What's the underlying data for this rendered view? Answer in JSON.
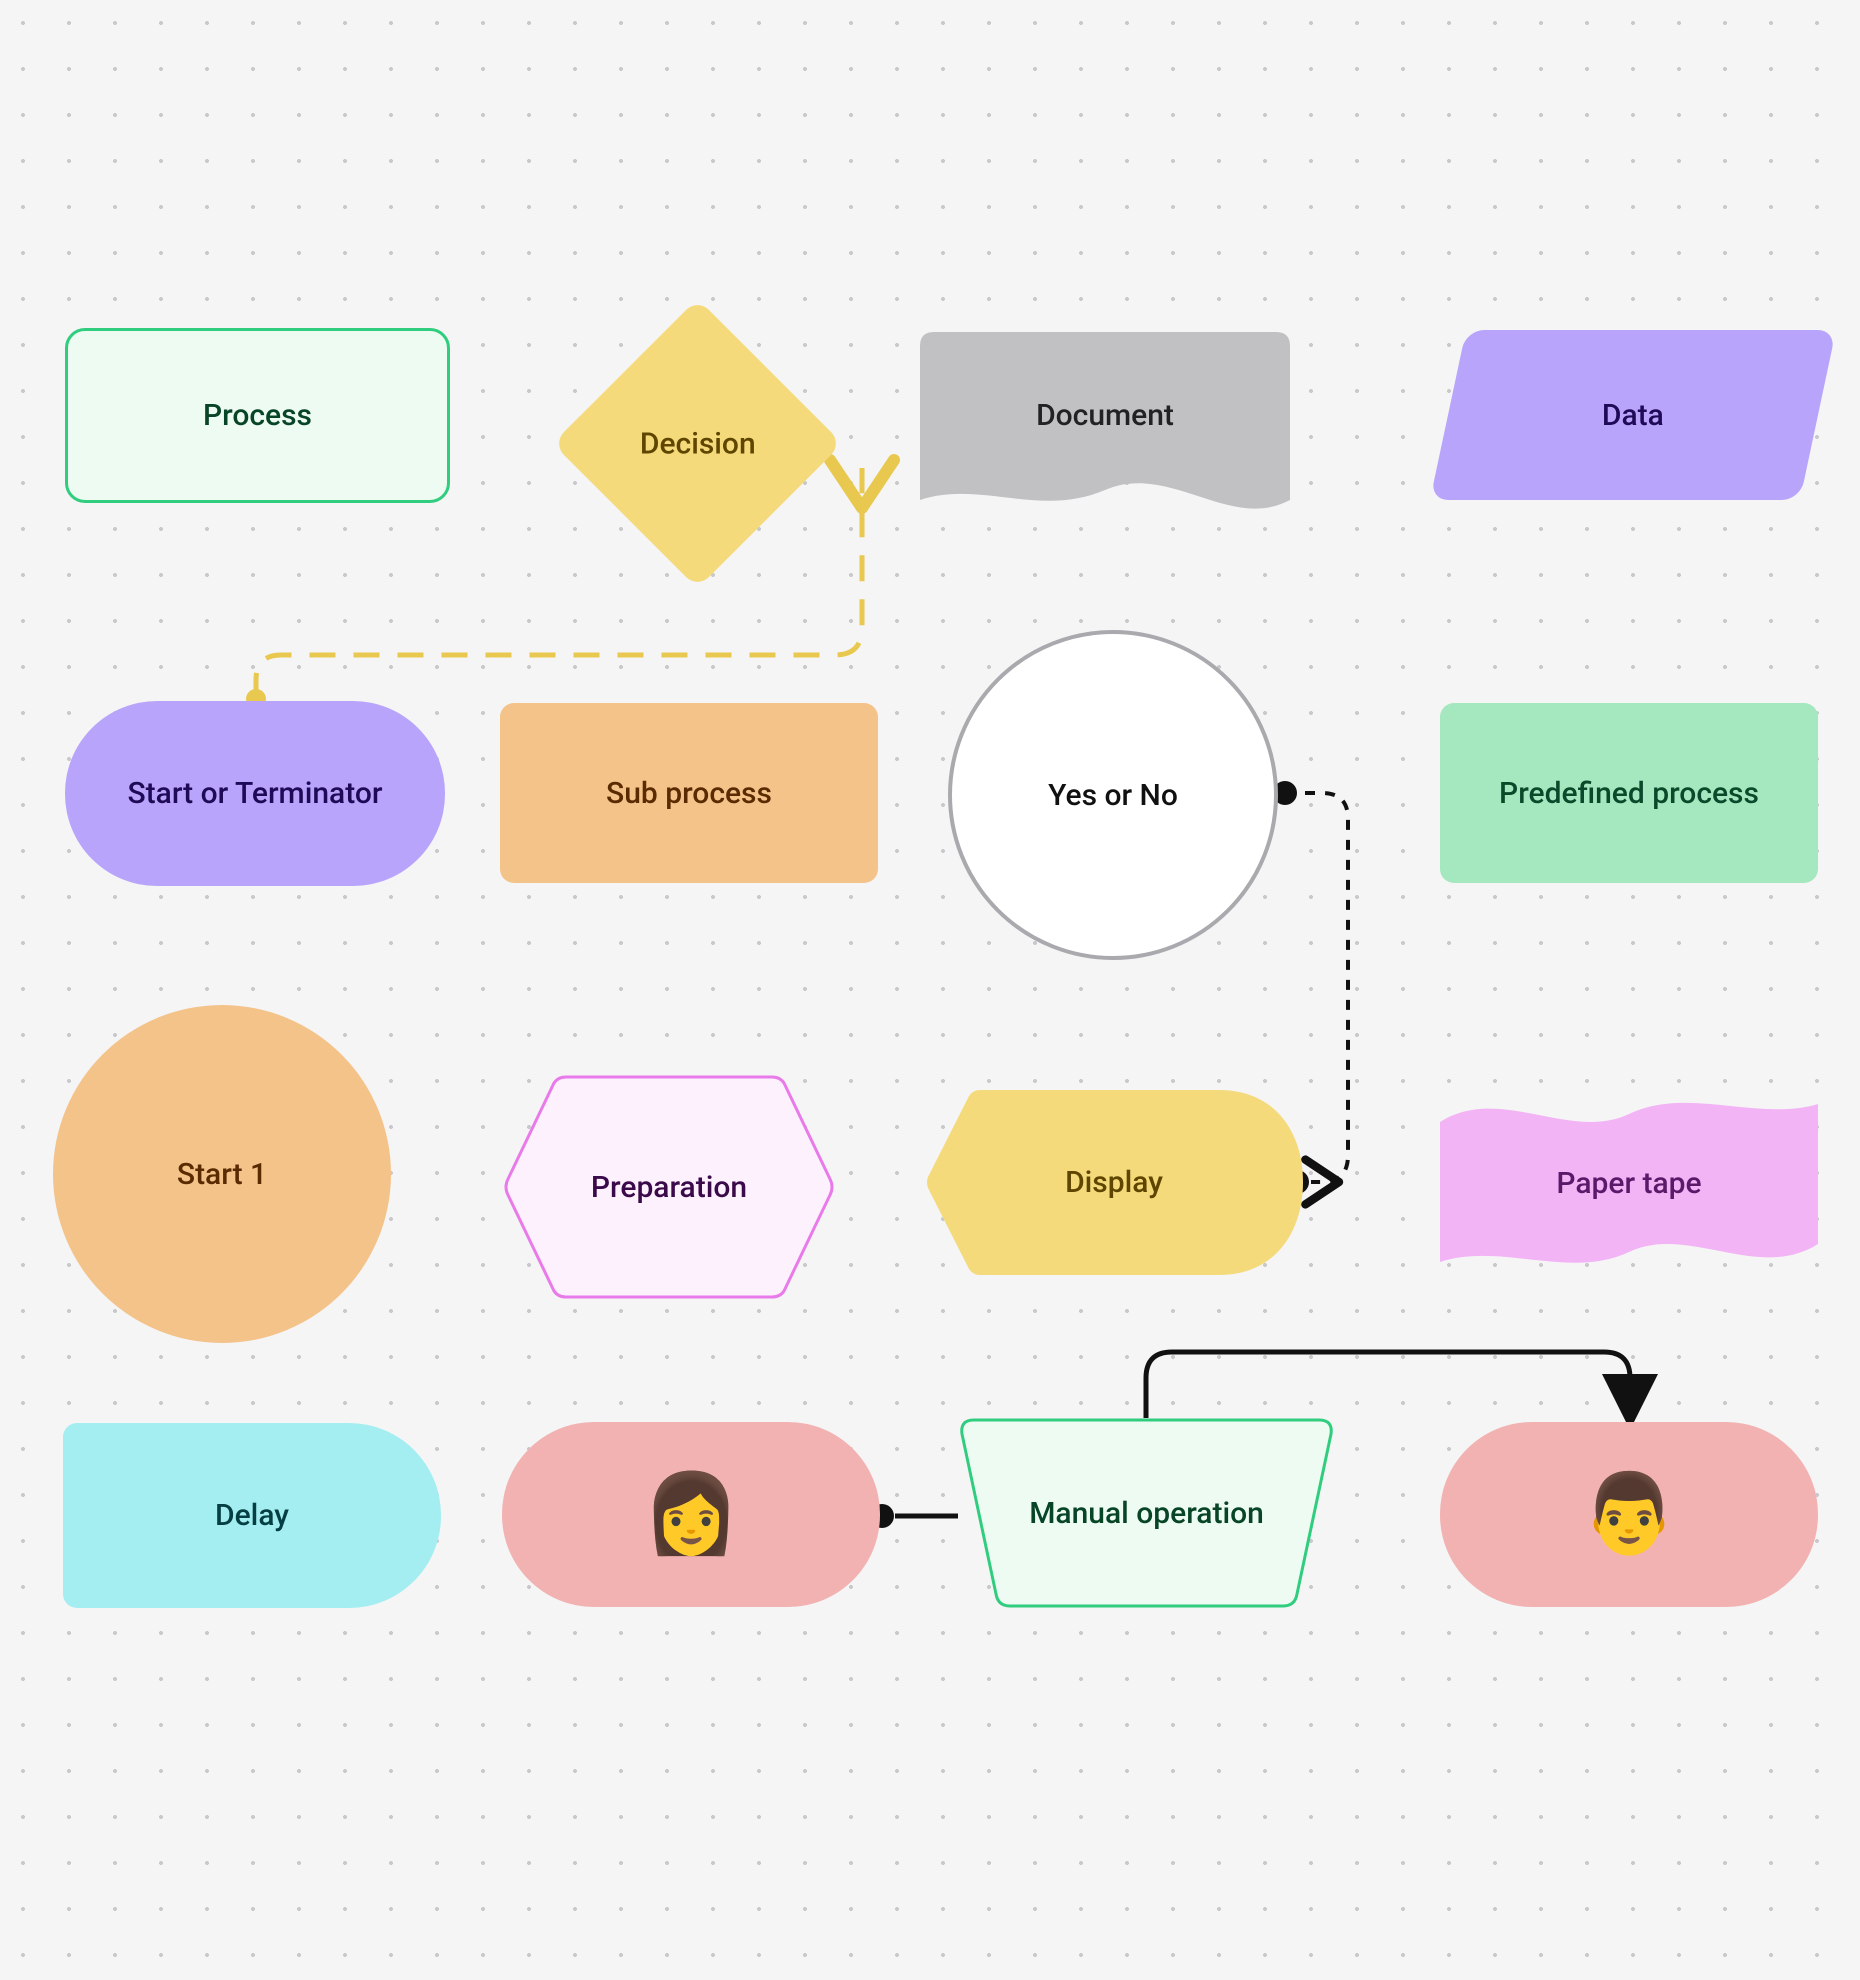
{
  "nodes": {
    "process": {
      "label": "Process"
    },
    "decision": {
      "label": "Decision"
    },
    "document": {
      "label": "Document"
    },
    "data": {
      "label": "Data"
    },
    "terminator": {
      "label": "Start or Terminator"
    },
    "subprocess": {
      "label": "Sub process"
    },
    "yesno": {
      "label": "Yes or No"
    },
    "predefined": {
      "label": "Predefined process"
    },
    "start1": {
      "label": "Start 1"
    },
    "preparation": {
      "label": "Preparation"
    },
    "display": {
      "label": "Display"
    },
    "papertape": {
      "label": "Paper tape"
    },
    "delay": {
      "label": "Delay"
    },
    "woman": {
      "label": "👩"
    },
    "manual": {
      "label": "Manual operation"
    },
    "man": {
      "label": "👨"
    }
  },
  "connectors": [
    {
      "from": "terminator",
      "to": "decision",
      "style": "dashed-yellow",
      "arrow": "open"
    },
    {
      "from": "yesno",
      "to": "display",
      "style": "dashed-black",
      "arrow": "open"
    },
    {
      "from": "manual",
      "to": "woman",
      "style": "solid-black",
      "arrow": "open"
    },
    {
      "from": "manual",
      "to": "man",
      "style": "solid-black",
      "arrow": "filled"
    }
  ],
  "colors": {
    "greenBorder": "#30cd7f",
    "greenFillLite": "#edfbf2",
    "greenFill": "#a5e8bf",
    "yellow": "#f4da7a",
    "gray": "#c1c1c4",
    "purple": "#b8a4fa",
    "orange": "#f4c38a",
    "pinkLite": "#fdf1fe",
    "pinkBorder": "#e87be9",
    "pinkFill": "#f2b4f5",
    "salmon": "#f2b2b2",
    "cyan": "#a4eef1"
  }
}
